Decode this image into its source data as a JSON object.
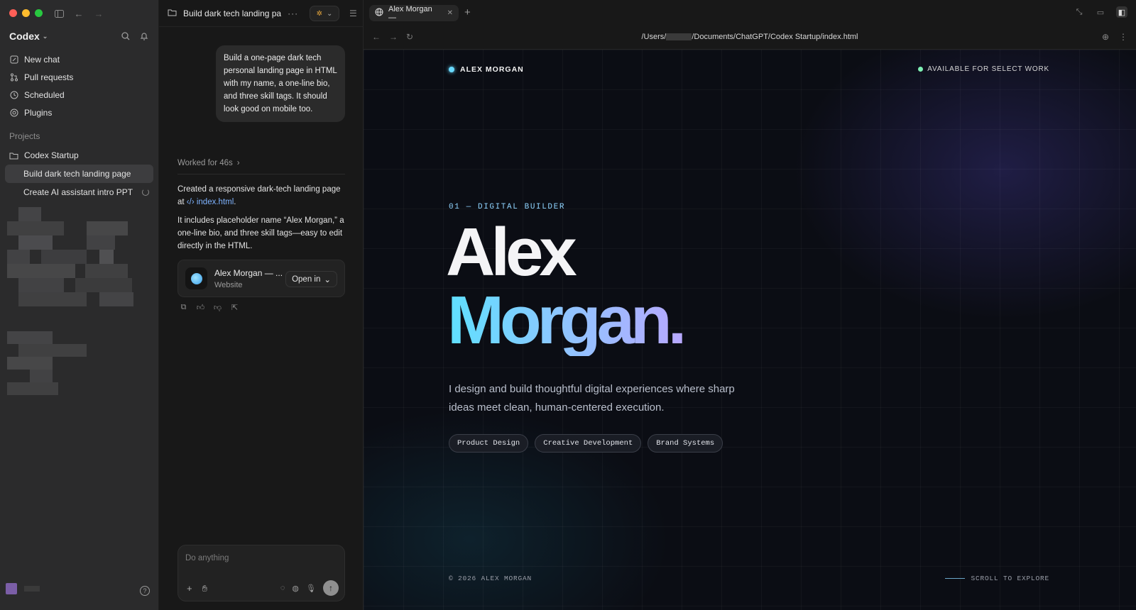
{
  "sidebar": {
    "brand": "Codex",
    "nav": [
      {
        "label": "New chat",
        "icon": "compose-icon"
      },
      {
        "label": "Pull requests",
        "icon": "pull-request-icon"
      },
      {
        "label": "Scheduled",
        "icon": "clock-icon"
      },
      {
        "label": "Plugins",
        "icon": "plugin-icon"
      }
    ],
    "projects_label": "Projects",
    "project": "Codex Startup",
    "threads": [
      {
        "label": "Build dark tech landing page",
        "active": true
      },
      {
        "label": "Create AI assistant intro PPT",
        "loading": true
      }
    ]
  },
  "chat": {
    "title": "Build dark tech landing pa",
    "user_message": "Build a one-page dark tech personal landing page in HTML with my name, a one-line bio, and three skill tags. It should look good on mobile too.",
    "worked": "Worked for 46s",
    "reply_1_prefix": "Created a responsive dark-tech landing page at ",
    "reply_1_link": "index.html",
    "reply_1_suffix": ".",
    "reply_2": "It includes placeholder name “Alex Morgan,” a one-line bio, and three skill tags—easy to edit directly in the HTML.",
    "card": {
      "title": "Alex Morgan — ...",
      "subtitle": "Website",
      "open_label": "Open in"
    },
    "composer_placeholder": "Do anything"
  },
  "browser": {
    "tab_title": "Alex Morgan —",
    "url_prefix": "/Users/",
    "url_suffix": "/Documents/ChatGPT/Codex Startup/index.html"
  },
  "landing": {
    "brand": "ALEX MORGAN",
    "availability": "AVAILABLE FOR SELECT WORK",
    "kicker": "01 — DIGITAL BUILDER",
    "name_line1": "Alex",
    "name_line2": "Morgan.",
    "bio": "I design and build thoughtful digital experiences where sharp ideas meet clean, human-centered execution.",
    "tags": [
      "Product Design",
      "Creative Development",
      "Brand Systems"
    ],
    "footer": "© 2026 ALEX MORGAN",
    "scroll": "SCROLL TO EXPLORE"
  },
  "colors": {
    "accent_cyan": "#69d9ff",
    "status_green": "#7ef0b4",
    "link_blue": "#7fb3ff"
  }
}
